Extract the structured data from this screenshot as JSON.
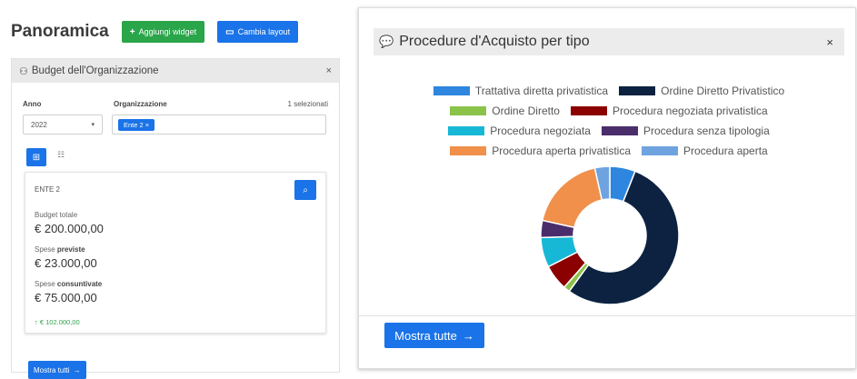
{
  "header": {
    "title": "Panoramica",
    "add_widget_label": "Aggiungi widget",
    "change_layout_label": "Cambia layout"
  },
  "budget_panel": {
    "title": "Budget dell'Organizzazione",
    "anno_label": "Anno",
    "org_label": "Organizzazione",
    "selected_count": "1 selezionati",
    "year_value": "2022",
    "org_chip": "Ente 2 ×",
    "card": {
      "ente_name": "ENTE 2",
      "budget_label": "Budget totale",
      "budget_value": "€ 200.000,00",
      "previste_label_a": "Spese ",
      "previste_label_b": "previste",
      "previste_value": "€ 23.000,00",
      "consuntivate_label_a": "Spese ",
      "consuntivate_label_b": "consuntivate",
      "consuntivate_value": "€ 75.000,00",
      "delta": "€ 102.000,00"
    },
    "show_all_label": "Mostra tutti"
  },
  "procedure_panel": {
    "title": "Procedure d'Acquisto per tipo",
    "show_all_label": "Mostra tutte"
  },
  "chart_data": {
    "type": "pie",
    "donut": true,
    "legend_position": "top",
    "series": [
      {
        "name": "Trattativa diretta privatistica",
        "value": 6,
        "color": "#2e86de"
      },
      {
        "name": "Ordine Diretto Privatistico",
        "value": 54,
        "color": "#0d2240"
      },
      {
        "name": "Ordine Diretto",
        "value": 1.5,
        "color": "#8bc34a"
      },
      {
        "name": "Procedura negoziata privatistica",
        "value": 6,
        "color": "#8b0000"
      },
      {
        "name": "Procedura negoziata",
        "value": 7,
        "color": "#17b8d6"
      },
      {
        "name": "Procedura senza tipologia",
        "value": 4,
        "color": "#4a2d6b"
      },
      {
        "name": "Procedura aperta privatistica",
        "value": 18,
        "color": "#f0904a"
      },
      {
        "name": "Procedura aperta",
        "value": 3.5,
        "color": "#6fa3e0"
      }
    ]
  }
}
